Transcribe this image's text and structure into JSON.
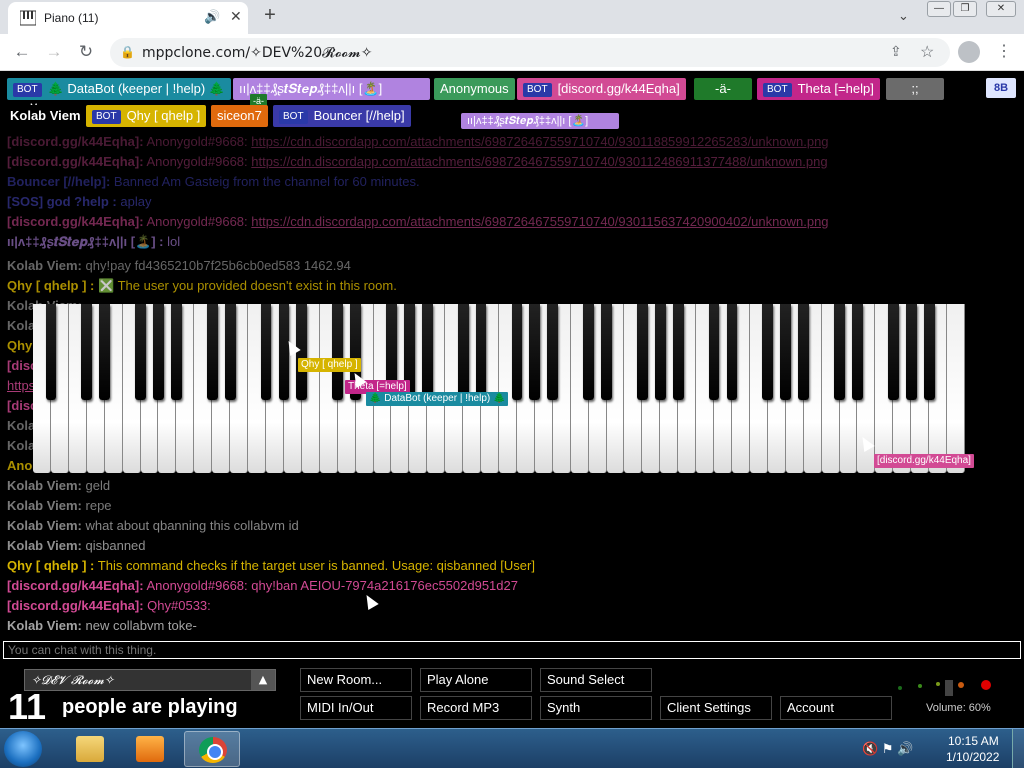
{
  "browser": {
    "tab_title": "Piano (11)",
    "tab_close": "✕",
    "new_tab": "+",
    "tabs_menu": "⌄",
    "win_min": "—",
    "win_max": "❐",
    "win_close": "✕",
    "back": "←",
    "forward": "→",
    "reload": "↻",
    "lock": "🔒",
    "url": "mppclone.com/✧DEV%20𝓡𝓸𝓸𝓶✧",
    "share": "⇪",
    "star": "☆",
    "menu": "⋮"
  },
  "users_row1": [
    {
      "bot": "BOT",
      "name": "🌲 DataBot (keeper | !help) 🌲",
      "color": "#1a8ba0"
    },
    {
      "name": "ıı|ʌ‡‡₰ʂ𝒕𝑺𝒕𝒆𝒑₰‡‡ʌ||ı [🏝️]",
      "color": "#b083e0"
    },
    {
      "name": "Anonymous",
      "color": "#3a9a5a"
    },
    {
      "bot": "BOT",
      "name": "[discord.gg/k44Eqha]",
      "color": "#d24a94"
    },
    {
      "name": "-ä-",
      "color": "#1f7a2a"
    },
    {
      "bot": "BOT",
      "name": "Theta [=help]",
      "color": "#c2268a"
    },
    {
      "name": ";;",
      "color": "#6b6b6b"
    }
  ],
  "users_row2": [
    {
      "name": "Kolab Viem",
      "color": "#000000"
    },
    {
      "bot": "BOT",
      "name": "Qhy [ qhelp ]",
      "color": "#d6b400"
    },
    {
      "name": "siceon7",
      "color": "#e06a0d"
    },
    {
      "bot": "BOT",
      "name": "Bouncer [//help]",
      "color": "#3a3aa8"
    }
  ],
  "room_owner_tag": "8B",
  "floating_tag": "ıı|ʌ‡‡₰ʂ𝒕𝑺𝒕𝒆𝒑₰‡‡ʌ||ı [🏝️]",
  "small_me": "Me",
  "small_a": "-ä-",
  "chat": [
    {
      "name": "[discord.gg/k44Eqha]:",
      "nc": "#d24a94",
      "text": "Anonygold#9668: ",
      "link": "https://cdn.discordapp.com/attachments/698726467559710740/930118859912265283/unknown.png",
      "tc": "#d24a94",
      "op": 0.35
    },
    {
      "name": "[discord.gg/k44Eqha]:",
      "nc": "#d24a94",
      "text": "Anonygold#9668: ",
      "link": "https://cdn.discordapp.com/attachments/698726467559710740/930112486911377488/unknown.png",
      "tc": "#d24a94",
      "op": 0.4
    },
    {
      "name": "Bouncer [//help]:",
      "nc": "#4a4ad0",
      "text": "Banned Am Gasteig from the channel for 60 minutes.",
      "tc": "#4a4ad0",
      "op": 0.45
    },
    {
      "name": "[SOS] god ?help :",
      "nc": "#5050d8",
      "text": "aplay",
      "tc": "#5050d8",
      "op": 0.5
    },
    {
      "name": "[discord.gg/k44Eqha]:",
      "nc": "#d24a94",
      "text": "Anonygold#9668: ",
      "link": "https://cdn.discordapp.com/attachments/698726467559710740/930115637420900402/unknown.png",
      "tc": "#d24a94",
      "op": 0.55
    },
    {
      "name": "ıı|ʌ‡‡₰ʂ𝒕𝑺𝒕𝒆𝒑₰‡‡ʌ||ı [🏝️] :",
      "nc": "#b083e0",
      "text": "lol",
      "tc": "#b083e0",
      "op": 0.6
    },
    {
      "name": "Kolab Viem:",
      "nc": "#cccccc",
      "text": "qhy!pay fd4365210b7f25b6cb0ed583 1462.94",
      "tc": "#cccccc",
      "op": 0.5
    },
    {
      "name": "Qhy [ qhelp ] :",
      "nc": "#d6b400",
      "text": "❎ The user you provided doesn't exist in this room.",
      "tc": "#d6b400",
      "op": 0.75
    },
    {
      "name": "Kolab Viem:",
      "nc": "#cccccc",
      "text": "",
      "tc": "#cccccc",
      "op": 0.5
    },
    {
      "name": "Kolab Viem:",
      "nc": "#cccccc",
      "text": "",
      "tc": "#cccccc",
      "op": 0.5
    },
    {
      "name": "Qhy [ qhelp ] :",
      "nc": "#d6b400",
      "text": "",
      "tc": "#d6b400",
      "op": 0.8
    },
    {
      "name": "[discord.gg/k44Eqha]:",
      "nc": "#d24a94",
      "text": "",
      "tc": "#d24a94",
      "op": 0.8
    },
    {
      "name": "https://",
      "nc": "#d24a94",
      "text": "",
      "tc": "#d24a94",
      "op": 0.8
    },
    {
      "name": "[discord.gg/k44Eqha]:",
      "nc": "#d24a94",
      "text": "",
      "tc": "#d24a94",
      "op": 0.8
    },
    {
      "name": "Kolab Viem:",
      "nc": "#cccccc",
      "text": "",
      "tc": "#cccccc",
      "op": 0.5
    },
    {
      "name": "Kolab Viem:",
      "nc": "#cccccc",
      "text": "",
      "tc": "#cccccc",
      "op": 0.5
    },
    {
      "name": "Anonymous:",
      "nc": "#d6b400",
      "text": "",
      "tc": "#d6b400",
      "op": 0.8
    },
    {
      "name": "Kolab Viem:",
      "nc": "#cccccc",
      "text": "geld",
      "tc": "#cccccc",
      "op": 0.6
    },
    {
      "name": "Kolab Viem:",
      "nc": "#cccccc",
      "text": "repe",
      "tc": "#cccccc",
      "op": 0.6
    },
    {
      "name": "Kolab Viem:",
      "nc": "#cccccc",
      "text": "what about qbanning this collabvm id",
      "tc": "#cccccc",
      "op": 0.65
    },
    {
      "name": "Kolab Viem:",
      "nc": "#cccccc",
      "text": "qisbanned",
      "tc": "#cccccc",
      "op": 0.7
    },
    {
      "name": "Qhy [ qhelp ] :",
      "nc": "#d6b400",
      "text": "This command checks if the target user is banned. Usage: qisbanned [User]",
      "tc": "#d6b400",
      "op": 1
    },
    {
      "name": "[discord.gg/k44Eqha]:",
      "nc": "#d24a94",
      "text": "Anonygold#9668: qhy!ban AEIOU-7974a216176ec5502d951d27",
      "tc": "#d24a94",
      "op": 1
    },
    {
      "name": "[discord.gg/k44Eqha]:",
      "nc": "#d24a94",
      "text": "Qhy#0533:",
      "tc": "#d24a94",
      "op": 1
    },
    {
      "name": "Kolab Viem:",
      "nc": "#cccccc",
      "text": "new collabvm toke-",
      "tc": "#cccccc",
      "op": 0.8
    }
  ],
  "cursor_labels": [
    {
      "name": "Qhy [ qhelp ]",
      "color": "#d6b400"
    },
    {
      "name": "Theta [=help]",
      "color": "#c2268a"
    },
    {
      "name": "🌲 DataBot (keeper | !help) 🌲",
      "color": "#1a8ba0"
    },
    {
      "name": "[discord.gg/k44Eqha]",
      "color": "#d24a94"
    }
  ],
  "chat_placeholder": "You can chat with this thing.",
  "room_name": "✧𝓓𝓔𝓥 𝓡𝓸𝓸𝓶✧",
  "players_count": "11",
  "players_text": "people are playing",
  "buttons": {
    "new_room": "New Room...",
    "play_alone": "Play Alone",
    "sound_select": "Sound Select",
    "midi": "MIDI In/Out",
    "record": "Record MP3",
    "synth": "Synth",
    "client_settings": "Client Settings",
    "account": "Account"
  },
  "volume_label": "Volume: 60%",
  "volume_level": 0.6,
  "taskbar": {
    "tray": "🔇 ⚑ 🔊",
    "time": "10:15 AM",
    "date": "1/10/2022"
  }
}
